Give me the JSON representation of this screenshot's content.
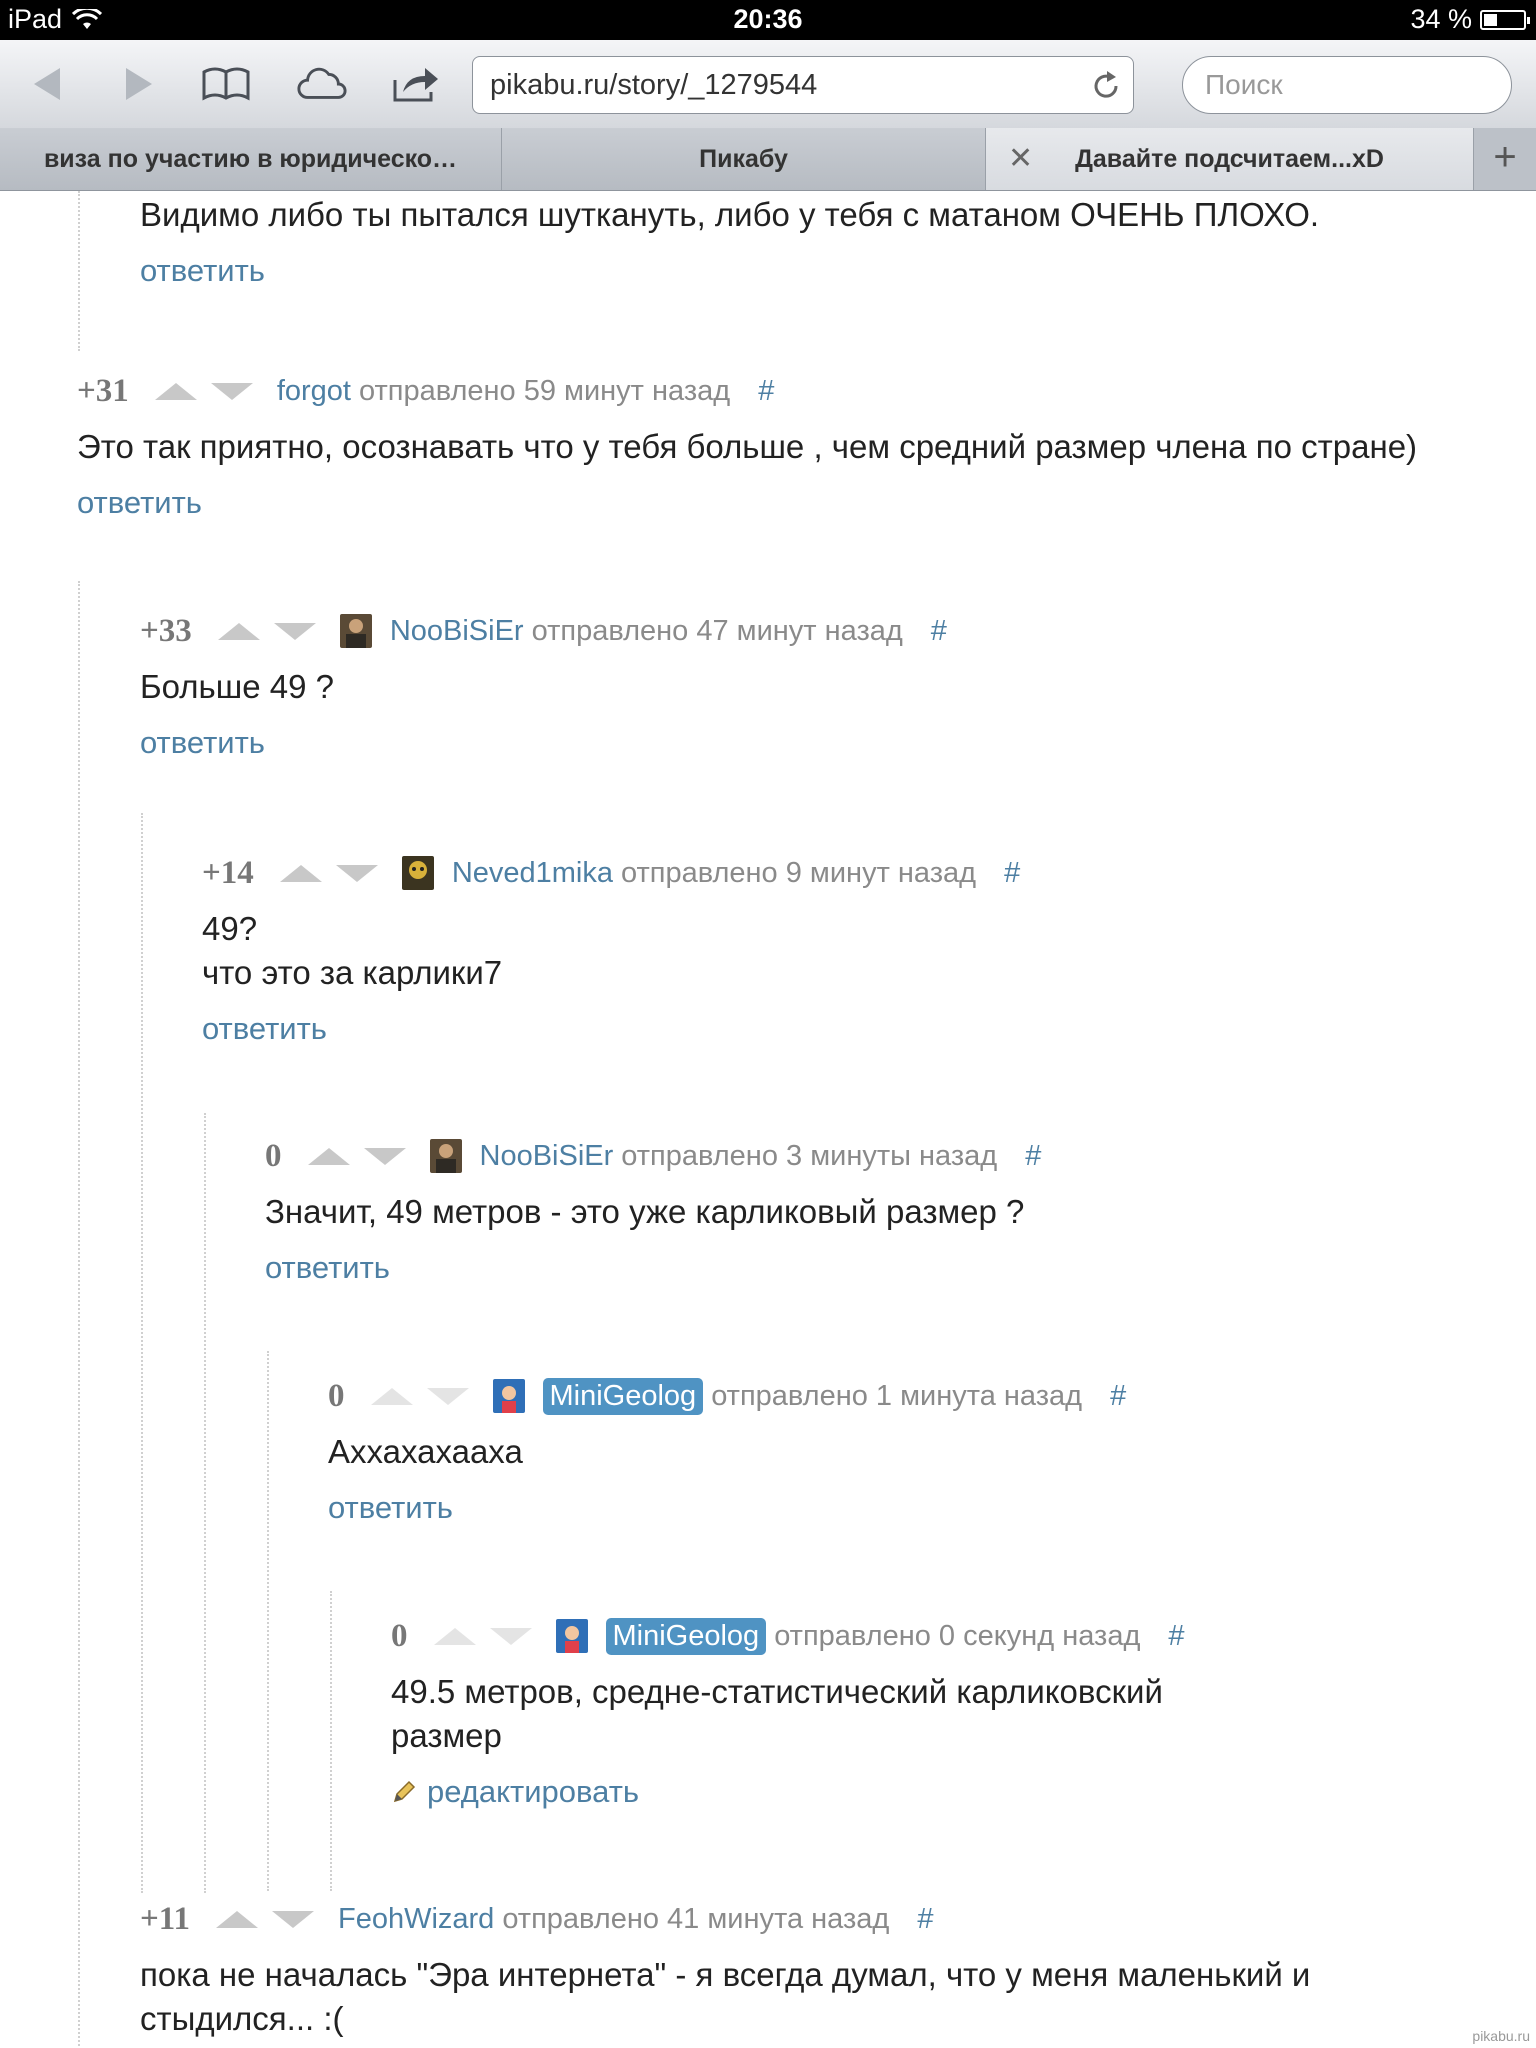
{
  "status": {
    "device": "iPad",
    "time": "20:36",
    "battery": "34 %",
    "battery_level": 0.34
  },
  "toolbar": {
    "url": "pikabu.ru/story/_1279544",
    "search_placeholder": "Поиск"
  },
  "tabs": [
    {
      "label": "виза по участию в юридическо…"
    },
    {
      "label": "Пикабу"
    },
    {
      "label": "Давайте подсчитаем...xD"
    }
  ],
  "top_fragment": {
    "text": "Видимо либо ты пытался шуткануть, либо у тебя с матаном ОЧЕНЬ ПЛОХО.",
    "reply": "ответить"
  },
  "comments": [
    {
      "rating": "+31",
      "author": "forgot",
      "sent": "отправлено 59 минут назад",
      "hash": "#",
      "lines": [
        "Это так приятно, осознавать что у тебя больше , чем средний размер члена по стране)"
      ],
      "reply": "ответить"
    },
    {
      "rating": "+33",
      "author": "NooBiSiEr",
      "sent": "отправлено 47 минут назад",
      "hash": "#",
      "lines": [
        "Больше 49 ?"
      ],
      "reply": "ответить"
    },
    {
      "rating": "+14",
      "author": "Neved1mika",
      "sent": "отправлено 9 минут назад",
      "hash": "#",
      "lines": [
        "49?",
        "что это за карлики7"
      ],
      "reply": "ответить"
    },
    {
      "rating": "0",
      "author": "NooBiSiEr",
      "sent": "отправлено 3 минуты назад",
      "hash": "#",
      "lines": [
        "Значит, 49 метров - это уже карликовый размер ?"
      ],
      "reply": "ответить"
    },
    {
      "rating": "0",
      "author": "MiniGeolog",
      "sent": "отправлено 1 минута назад",
      "hash": "#",
      "lines": [
        "Аххахахааха"
      ],
      "reply": "ответить"
    },
    {
      "rating": "0",
      "author": "MiniGeolog",
      "sent": "отправлено 0 секунд назад",
      "hash": "#",
      "lines": [
        "49.5 метров, средне-статистический карликовский",
        "размер"
      ],
      "reply": "редактировать"
    },
    {
      "rating": "+11",
      "author": "FeohWizard",
      "sent": "отправлено 41 минута назад",
      "hash": "#",
      "lines": [
        "пока не началась \"Эра интернета\" - я всегда думал, что у меня маленький и",
        "стыдился... :("
      ]
    }
  ],
  "watermark": "pikabu.ru"
}
